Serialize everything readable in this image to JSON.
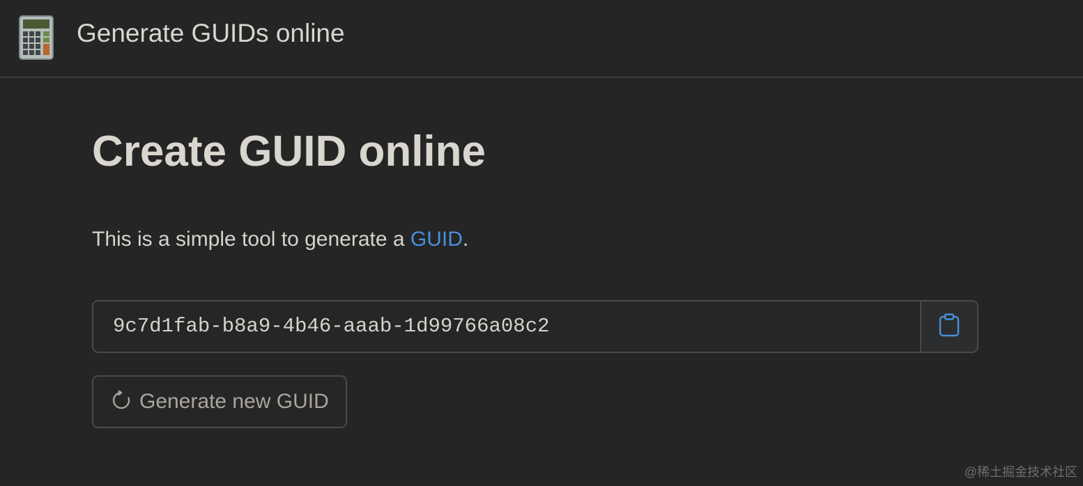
{
  "header": {
    "app_icon": "calculator-icon",
    "title": "Generate GUIDs online"
  },
  "main": {
    "title": "Create GUID online",
    "intro_text": "This is a simple tool to generate a ",
    "intro_link": "GUID",
    "intro_suffix": "."
  },
  "guid": {
    "value": "9c7d1fab-b8a9-4b46-aaab-1d99766a08c2",
    "copy_icon": "clipboard-icon"
  },
  "generate_button": {
    "icon": "refresh-icon",
    "label": "Generate new GUID"
  },
  "watermark": "@稀土掘金技术社区",
  "colors": {
    "background": "#252525",
    "text": "#d6d3cc",
    "link": "#4a90d9",
    "border": "#4a4a4a",
    "muted_button_text": "#a9a59d"
  }
}
